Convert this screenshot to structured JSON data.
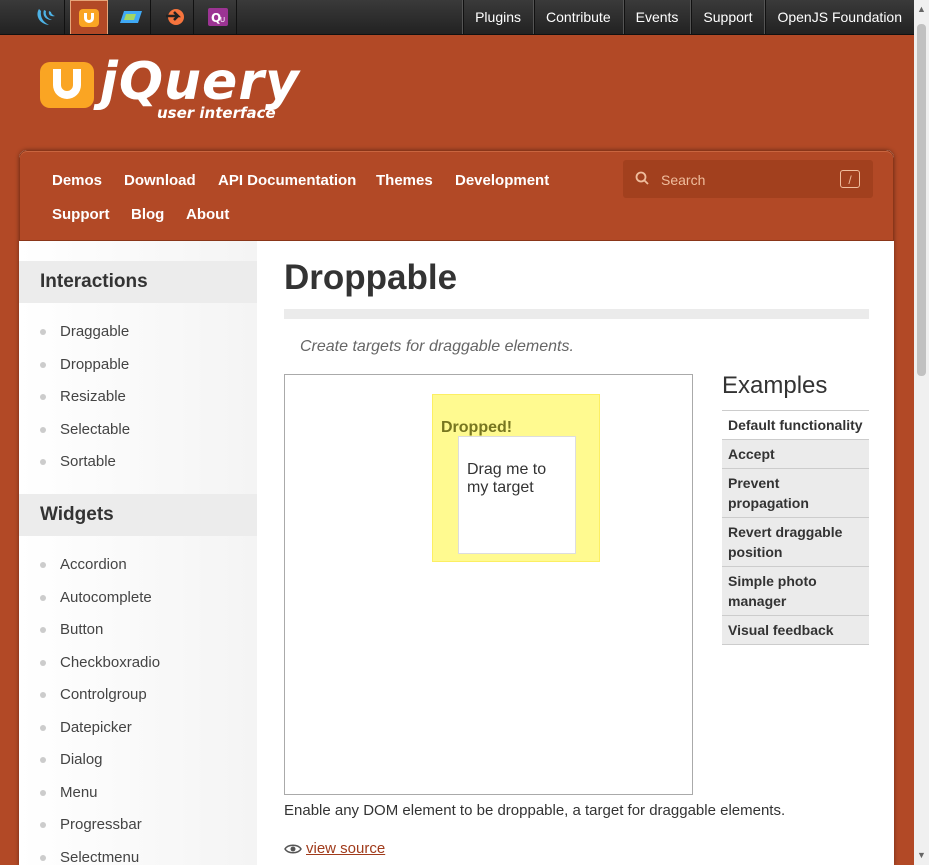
{
  "topbar": {
    "projects": [
      {
        "name": "jquery-project-icon",
        "color": "#4db3e6"
      },
      {
        "name": "jquery-ui-project-icon",
        "color": "#faa523"
      },
      {
        "name": "jquery-mobile-project-icon",
        "color": "#3fa9f5"
      },
      {
        "name": "sizzle-project-icon",
        "color": "#f6743d"
      },
      {
        "name": "qunit-project-icon",
        "color": "#9c3493"
      }
    ],
    "links": [
      "Plugins",
      "Contribute",
      "Events",
      "Support",
      "OpenJS Foundation"
    ]
  },
  "logo": {
    "main": "jQuery",
    "sub": "user interface"
  },
  "nav": {
    "items": [
      "Demos",
      "Download",
      "API Documentation",
      "Themes",
      "Development",
      "Support",
      "Blog",
      "About"
    ],
    "search_placeholder": "Search",
    "search_shortcut": "/"
  },
  "sidebar": {
    "interactions_heading": "Interactions",
    "interactions": [
      "Draggable",
      "Droppable",
      "Resizable",
      "Selectable",
      "Sortable"
    ],
    "widgets_heading": "Widgets",
    "widgets": [
      "Accordion",
      "Autocomplete",
      "Button",
      "Checkboxradio",
      "Controlgroup",
      "Datepicker",
      "Dialog",
      "Menu",
      "Progressbar",
      "Selectmenu"
    ]
  },
  "main": {
    "title": "Droppable",
    "subtitle": "Create targets for draggable elements.",
    "drop_label": "Dropped!",
    "drag_label": "Drag me to my target",
    "description": "Enable any DOM element to be droppable, a target for draggable elements.",
    "view_source": "view source"
  },
  "examples": {
    "heading": "Examples",
    "items": [
      "Default functionality",
      "Accept",
      "Prevent propagation",
      "Revert draggable position",
      "Simple photo manager",
      "Visual feedback"
    ]
  },
  "colors": {
    "brand": "#b24926",
    "drop_bg": "#fffa90",
    "drop_text": "#777620"
  }
}
